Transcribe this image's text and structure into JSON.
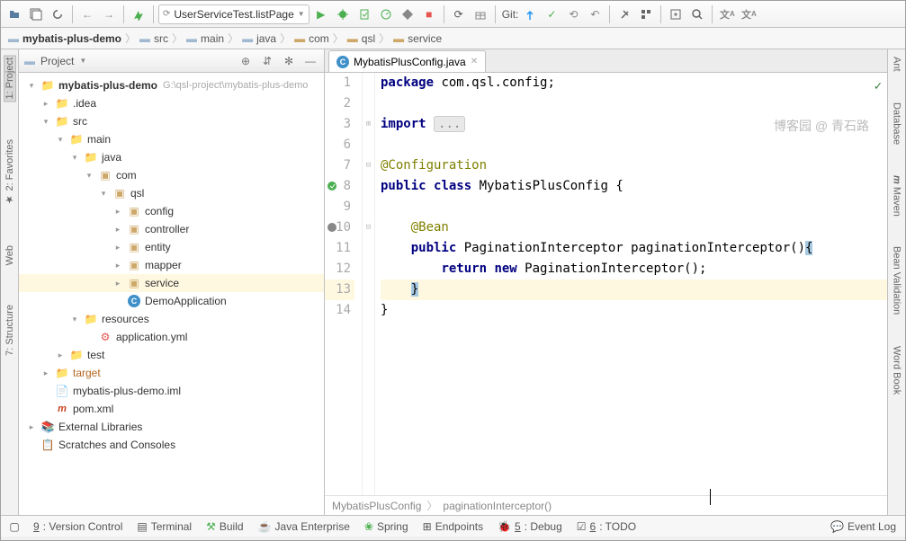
{
  "toolbar": {
    "run_config": "UserServiceTest.listPage",
    "git_label": "Git:"
  },
  "breadcrumb": [
    {
      "icon": "folder",
      "label": "mybatis-plus-demo",
      "bold": true
    },
    {
      "icon": "folder",
      "label": "src"
    },
    {
      "icon": "folder",
      "label": "main"
    },
    {
      "icon": "folder",
      "label": "java"
    },
    {
      "icon": "pkg",
      "label": "com"
    },
    {
      "icon": "pkg",
      "label": "qsl"
    },
    {
      "icon": "pkg",
      "label": "service"
    }
  ],
  "left_tools": [
    "1: Project",
    "2: Favorites",
    "Web",
    "7: Structure"
  ],
  "right_tools": [
    "Ant",
    "Database",
    "Maven",
    "Bean Validation",
    "Word Book"
  ],
  "project": {
    "title": "Project",
    "tree": [
      {
        "d": 0,
        "exp": true,
        "icon": "folder",
        "label": "mybatis-plus-demo",
        "hint": "G:\\qsl-project\\mybatis-plus-demo",
        "bold": true
      },
      {
        "d": 1,
        "exp": false,
        "icon": "folder",
        "label": ".idea"
      },
      {
        "d": 1,
        "exp": true,
        "icon": "folder",
        "label": "src"
      },
      {
        "d": 2,
        "exp": true,
        "icon": "folder",
        "label": "main"
      },
      {
        "d": 3,
        "exp": true,
        "icon": "folder",
        "label": "java"
      },
      {
        "d": 4,
        "exp": true,
        "icon": "pkg",
        "label": "com"
      },
      {
        "d": 5,
        "exp": true,
        "icon": "pkg",
        "label": "qsl"
      },
      {
        "d": 6,
        "exp": false,
        "icon": "pkg",
        "label": "config"
      },
      {
        "d": 6,
        "exp": false,
        "icon": "pkg",
        "label": "controller"
      },
      {
        "d": 6,
        "exp": false,
        "icon": "pkg",
        "label": "entity"
      },
      {
        "d": 6,
        "exp": false,
        "icon": "pkg",
        "label": "mapper"
      },
      {
        "d": 6,
        "exp": false,
        "icon": "pkg",
        "label": "service",
        "sel": true
      },
      {
        "d": 6,
        "leaf": true,
        "icon": "java",
        "label": "DemoApplication"
      },
      {
        "d": 3,
        "exp": true,
        "icon": "folder-res",
        "label": "resources"
      },
      {
        "d": 4,
        "leaf": true,
        "icon": "yml",
        "label": "application.yml"
      },
      {
        "d": 2,
        "exp": false,
        "icon": "folder",
        "label": "test"
      },
      {
        "d": 1,
        "exp": false,
        "icon": "folder-orange",
        "label": "target"
      },
      {
        "d": 1,
        "leaf": true,
        "icon": "file",
        "label": "mybatis-plus-demo.iml"
      },
      {
        "d": 1,
        "leaf": true,
        "icon": "xml",
        "label": "pom.xml"
      },
      {
        "d": 0,
        "exp": false,
        "icon": "lib",
        "label": "External Libraries"
      },
      {
        "d": 0,
        "leaf": true,
        "icon": "scratch",
        "label": "Scratches and Consoles"
      }
    ]
  },
  "editor": {
    "tab_title": "MybatisPlusConfig.java",
    "watermark": "博客园 @ 青石路",
    "line_numbers": [
      "1",
      "2",
      "3",
      "6",
      "7",
      "8",
      "9",
      "10",
      "11",
      "12",
      "13",
      "14"
    ],
    "crumb1": "MybatisPlusConfig",
    "crumb2": "paginationInterceptor()"
  },
  "code": {
    "l1_kw": "package",
    "l1_rest": " com.qsl.config;",
    "l3_kw": "import",
    "l3_elide": "...",
    "l7": "@Configuration",
    "l8_kw1": "public",
    "l8_kw2": "class",
    "l8_rest": " MybatisPlusConfig {",
    "l10": "@Bean",
    "l11_kw": "public",
    "l11_rest": " PaginationInterceptor paginationInterceptor()",
    "l11_brace": "{",
    "l12_kw1": "return",
    "l12_kw2": "new",
    "l12_rest": " PaginationInterceptor();",
    "l13": "}",
    "l14": "}"
  },
  "bottom": {
    "vc_n": "9",
    "vc": ": Version Control",
    "term": "Terminal",
    "build": "Build",
    "je": "Java Enterprise",
    "spring": "Spring",
    "ep": "Endpoints",
    "dbg_n": "5",
    "dbg": ": Debug",
    "todo_n": "6",
    "todo": ": TODO",
    "log": "Event Log"
  }
}
